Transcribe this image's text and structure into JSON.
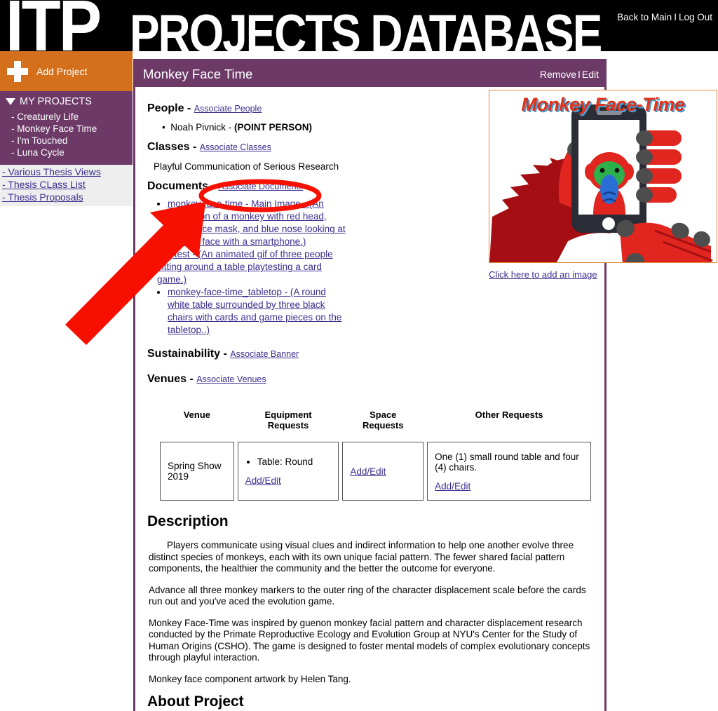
{
  "header": {
    "logo_primary": "ITP",
    "logo_secondary": "PROJECTS DATABASE",
    "back_link": "Back to Main",
    "separator": "I",
    "logout_link": "Log Out"
  },
  "sidebar": {
    "add_project_label": "Add Project",
    "my_projects_label": "MY PROJECTS",
    "projects": [
      "- Creaturely Life",
      "- Monkey Face Time",
      "- I'm Touched",
      "- Luna Cycle"
    ],
    "thesis_links": [
      "- Various Thesis Views",
      "- Thesis CLass List",
      "- Thesis Proposals"
    ]
  },
  "panel": {
    "title": "Monkey Face Time",
    "remove_label": "Remove",
    "action_separator": "I",
    "edit_label": "Edit"
  },
  "sections": {
    "people": {
      "heading": "People -",
      "assoc_link": "Associate People",
      "person": "Noah Pivnick - ",
      "person_role": "(POINT PERSON)"
    },
    "classes": {
      "heading": "Classes -",
      "assoc_link": "Associate Classes",
      "value": "Playful Communication of Serious Research"
    },
    "documents": {
      "heading": "Documents -",
      "assoc_link": "Associate Documents",
      "items": [
        "monkey-face-time - Main Image - (An illustration of a monkey with red head, green face mask, and blue nose looking at his own face with a smartphone.)",
        "playtest - (An animated gif of three people sitting around a table playtesting a card game.)",
        "monkey-face-time_tabletop - (A round white table surrounded by three black chairs with cards and game pieces on the tabletop..)"
      ]
    },
    "sustainability": {
      "heading": "Sustainability -",
      "assoc_link": "Associate Banner"
    },
    "venues": {
      "heading": "Venues -",
      "assoc_link": "Associate Venues"
    }
  },
  "image": {
    "title": "Monkey Face-Time",
    "add_image_link": "Click here to add an image",
    "alt": "Illustration of a red monkey with green face mask and blue nose taking a selfie with a smartphone"
  },
  "venue_table": {
    "columns": [
      "Venue",
      "Equipment\nRequests",
      "Space\nRequests",
      "Other Requests"
    ],
    "col_venue": "Venue",
    "col_equipment_l1": "Equipment",
    "col_equipment_l2": "Requests",
    "col_space_l1": "Space",
    "col_space_l2": "Requests",
    "col_other": "Other Requests",
    "rows": [
      {
        "venue": "Spring Show 2019",
        "equipment_items": [
          "Table: Round"
        ],
        "equipment_link": "Add/Edit",
        "space_link": "Add/Edit",
        "other_text": "One (1) small round table and four (4) chairs.",
        "other_link": "Add/Edit"
      }
    ]
  },
  "description": {
    "heading": "Description",
    "paragraphs": [
      "Players communicate using visual clues and indirect information to help one another evolve three distinct species of monkeys, each with its own unique facial pattern. The fewer shared facial pattern components, the healthier the community and the better the outcome for everyone.",
      "Advance all three monkey markers to the outer ring of the character displacement scale before the cards run out and you've aced the evolution game.",
      "Monkey Face-Time was inspired by guenon monkey facial pattern and character displacement research conducted by the Primate Reproductive Ecology and Evolution Group at NYU's Center for the Study of Human Origins (CSHO). The game is designed to foster mental models of complex evolutionary concepts through playful interaction.",
      "Monkey face component artwork by Helen Tang."
    ]
  },
  "about": {
    "heading": "About Project"
  },
  "colors": {
    "header_bg": "#000000",
    "accent_purple": "#6d3a68",
    "accent_orange": "#d4701c",
    "link_blue": "#3b2f8f",
    "annotation_red": "#f71000",
    "image_border": "#e0883c"
  },
  "annotations": {
    "ellipse_target": "Associate Documents",
    "arrow_target": "Associate Documents"
  }
}
